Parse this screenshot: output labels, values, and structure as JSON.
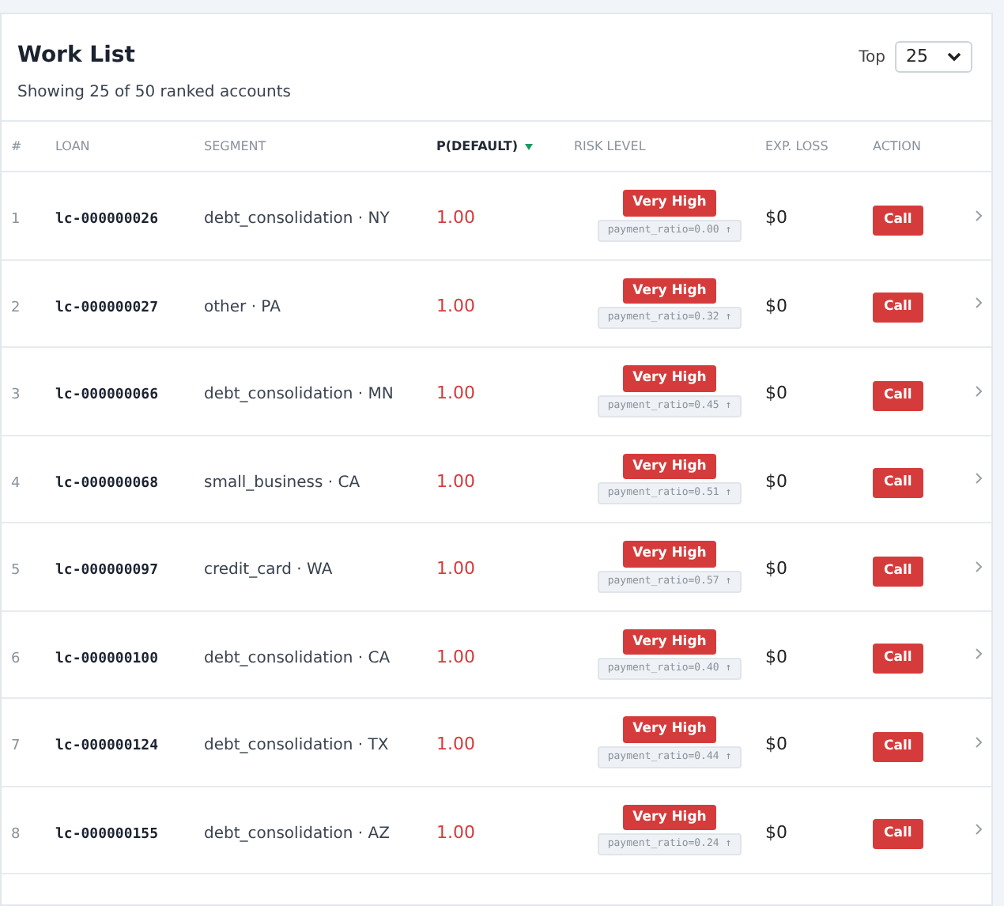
{
  "header": {
    "title": "Work List",
    "subtitle": "Showing 25 of 50 ranked accounts",
    "top_label": "Top",
    "top_select": {
      "value": "25"
    }
  },
  "table": {
    "columns": [
      {
        "label": "#",
        "sorted": false
      },
      {
        "label": "LOAN",
        "sorted": false
      },
      {
        "label": "SEGMENT",
        "sorted": false
      },
      {
        "label": "P(DEFAULT)",
        "sorted": true
      },
      {
        "label": "RISK LEVEL",
        "sorted": false
      },
      {
        "label": "EXP. LOSS",
        "sorted": false
      },
      {
        "label": "ACTION",
        "sorted": false
      }
    ],
    "rows": [
      {
        "rank": "1",
        "loan": "lc-000000026",
        "segment": "debt_consolidation · NY",
        "p_default": "1.00",
        "risk": "Very High",
        "driver": "payment_ratio=0.00 ↑",
        "exp_loss": "$0",
        "action": "Call"
      },
      {
        "rank": "2",
        "loan": "lc-000000027",
        "segment": "other · PA",
        "p_default": "1.00",
        "risk": "Very High",
        "driver": "payment_ratio=0.32 ↑",
        "exp_loss": "$0",
        "action": "Call"
      },
      {
        "rank": "3",
        "loan": "lc-000000066",
        "segment": "debt_consolidation · MN",
        "p_default": "1.00",
        "risk": "Very High",
        "driver": "payment_ratio=0.45 ↑",
        "exp_loss": "$0",
        "action": "Call"
      },
      {
        "rank": "4",
        "loan": "lc-000000068",
        "segment": "small_business · CA",
        "p_default": "1.00",
        "risk": "Very High",
        "driver": "payment_ratio=0.51 ↑",
        "exp_loss": "$0",
        "action": "Call"
      },
      {
        "rank": "5",
        "loan": "lc-000000097",
        "segment": "credit_card · WA",
        "p_default": "1.00",
        "risk": "Very High",
        "driver": "payment_ratio=0.57 ↑",
        "exp_loss": "$0",
        "action": "Call"
      },
      {
        "rank": "6",
        "loan": "lc-000000100",
        "segment": "debt_consolidation · CA",
        "p_default": "1.00",
        "risk": "Very High",
        "driver": "payment_ratio=0.40 ↑",
        "exp_loss": "$0",
        "action": "Call"
      },
      {
        "rank": "7",
        "loan": "lc-000000124",
        "segment": "debt_consolidation · TX",
        "p_default": "1.00",
        "risk": "Very High",
        "driver": "payment_ratio=0.44 ↑",
        "exp_loss": "$0",
        "action": "Call"
      },
      {
        "rank": "8",
        "loan": "lc-000000155",
        "segment": "debt_consolidation · AZ",
        "p_default": "1.00",
        "risk": "Very High",
        "driver": "payment_ratio=0.24 ↑",
        "exp_loss": "$0",
        "action": "Call"
      }
    ]
  }
}
